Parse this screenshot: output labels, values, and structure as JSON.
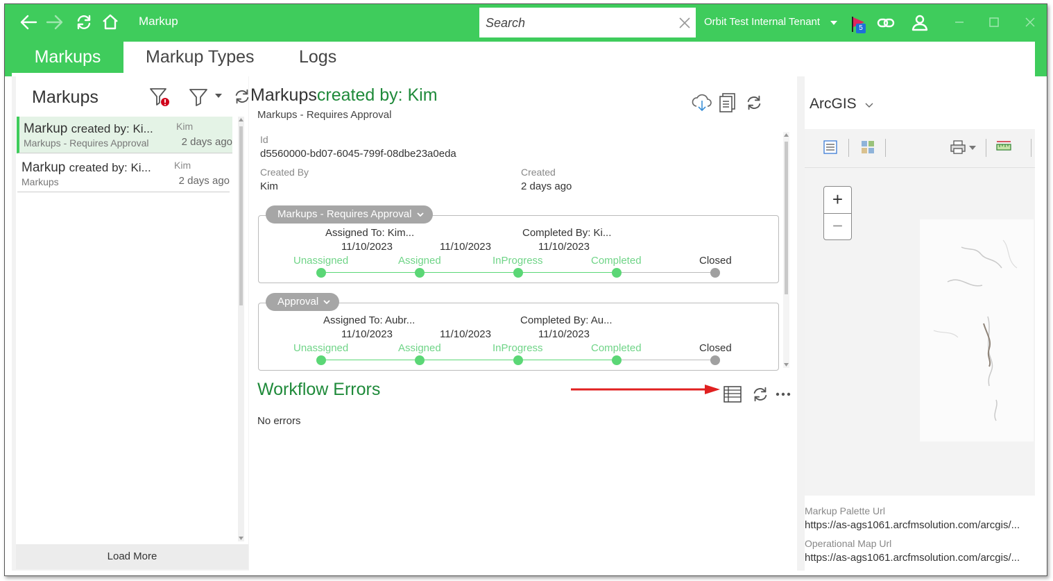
{
  "titlebar": {
    "title": "Markup",
    "search_placeholder": "Search",
    "tenant": "Orbit Test Internal Tenant",
    "notification_count": "5",
    "bg_color": "#3fcc5c"
  },
  "tabs": [
    {
      "label": "Markups",
      "active": true
    },
    {
      "label": "Markup Types",
      "active": false
    },
    {
      "label": "Logs",
      "active": false
    }
  ],
  "left": {
    "title": "Markups",
    "items": [
      {
        "title_a": "Markup",
        "title_b": "created by: Ki...",
        "subtitle": "Markups - Requires Approval",
        "user": "Kim",
        "time": "2 days ago",
        "selected": true
      },
      {
        "title_a": "Markup",
        "title_b": "created by: Ki...",
        "subtitle": "Markups",
        "user": "Kim",
        "time": "2 days ago",
        "selected": false
      }
    ],
    "load_more": "Load More"
  },
  "detail": {
    "title_a": "Markups",
    "title_b": "created by: Kim",
    "subtitle": "Markups - Requires Approval",
    "id_label": "Id",
    "id_value": "d5560000-bd07-6045-799f-08dbe23a0eda",
    "created_by_label": "Created By",
    "created_by_value": "Kim",
    "created_label": "Created",
    "created_value": "2 days ago",
    "workflows": [
      {
        "name": "Markups - Requires Approval",
        "assigned_to": "Assigned To: Kim...",
        "completed_by": "Completed By: Ki...",
        "dates": [
          "11/10/2023",
          "11/10/2023",
          "11/10/2023"
        ],
        "steps": [
          "Unassigned",
          "Assigned",
          "InProgress",
          "Completed",
          "Closed"
        ]
      },
      {
        "name": "Approval",
        "assigned_to": "Assigned To: Aubr...",
        "completed_by": "Completed By: Au...",
        "dates": [
          "11/10/2023",
          "11/10/2023",
          "11/10/2023"
        ],
        "steps": [
          "Unassigned",
          "Assigned",
          "InProgress",
          "Completed",
          "Closed"
        ]
      }
    ],
    "workflow_errors_title": "Workflow Errors",
    "no_errors": "No errors"
  },
  "right": {
    "title": "ArcGIS",
    "zoom_in": "+",
    "zoom_out": "−",
    "palette_label": "Markup Palette Url",
    "palette_value": "https://as-ags1061.arcfmsolution.com/arcgis/...",
    "opmap_label": "Operational Map Url",
    "opmap_value": "https://as-ags1061.arcfmsolution.com/arcgis/..."
  }
}
